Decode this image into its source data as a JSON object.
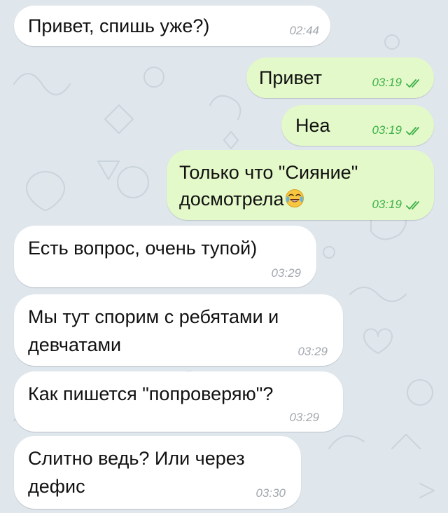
{
  "messages": [
    {
      "direction": "incoming",
      "text": "Привет, спишь уже?)",
      "time": "02:44"
    },
    {
      "direction": "outgoing",
      "text": "Привет",
      "time": "03:19",
      "status": "read"
    },
    {
      "direction": "outgoing",
      "text": "Неа",
      "time": "03:19",
      "status": "read"
    },
    {
      "direction": "outgoing",
      "lines": [
        "Только что \"Сияние\"",
        "досмотрела"
      ],
      "emoji": "😂",
      "emoji_icon": "face-with-tears-of-joy",
      "time": "03:19",
      "status": "read"
    },
    {
      "direction": "incoming",
      "text": "Есть вопрос, очень тупой)",
      "time": "03:29"
    },
    {
      "direction": "incoming",
      "lines": [
        "Мы тут спорим с ребятами и",
        "девчатами"
      ],
      "time": "03:29"
    },
    {
      "direction": "incoming",
      "text": "Как пишется \"попроверяю\"?",
      "time": "03:29"
    },
    {
      "direction": "incoming",
      "lines": [
        "Слитно ведь? Или через",
        "дефис"
      ],
      "time": "03:30"
    }
  ],
  "colors": {
    "background": "#dfe6ec",
    "incoming_bubble": "#ffffff",
    "outgoing_bubble": "#e4f9c9",
    "outgoing_time": "#3fb14a",
    "incoming_time": "#a2a8ae",
    "read_checks": "#3fb14a"
  }
}
